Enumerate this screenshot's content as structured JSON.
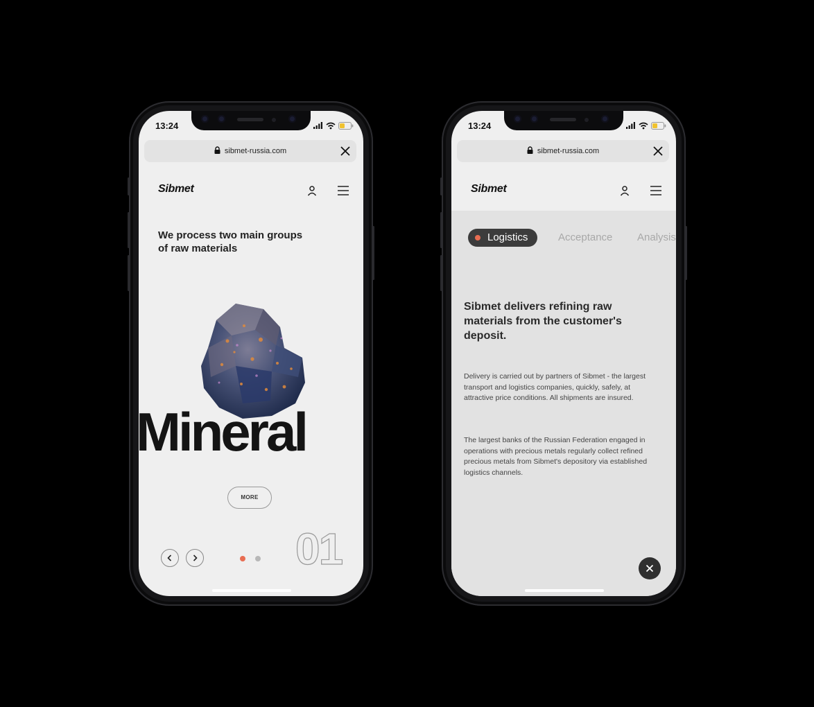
{
  "left_phone": {
    "status": {
      "time": "13:24"
    },
    "browser": {
      "url": "sibmet-russia.com"
    },
    "header": {
      "logo": "Sibmet"
    },
    "hero": {
      "headline": "We process two main groups of raw materials",
      "category": "Mineral",
      "more_label": "MORE",
      "slide_number": "01"
    },
    "pager": {
      "active_color": "#e86d52",
      "inactive_color": "#b8b8b8"
    }
  },
  "right_phone": {
    "status": {
      "time": "13:24"
    },
    "browser": {
      "url": "sibmet-russia.com"
    },
    "header": {
      "logo": "Sibmet"
    },
    "tabs": [
      "Logistics",
      "Acceptance",
      "Analysis"
    ],
    "title": "Sibmet delivers refining raw materials from the customer's deposit.",
    "paragraphs": [
      "Delivery is carried out by partners of Sibmet - the largest transport and logistics companies, quickly, safely, at attractive price conditions. All shipments are insured.",
      "The largest banks of the Russian Federation engaged in operations with precious metals regularly collect refined precious metals from Sibmet's depository via established logistics channels."
    ]
  },
  "colors": {
    "accent": "#e86d52",
    "background": "#000000",
    "screen_bg": "#efefef",
    "panel_bg": "#e2e2e2"
  },
  "icons": [
    "lock-icon",
    "close-icon",
    "user-icon",
    "menu-icon",
    "signal-icon",
    "wifi-icon",
    "battery-icon",
    "chevron-left-icon",
    "chevron-right-icon"
  ]
}
